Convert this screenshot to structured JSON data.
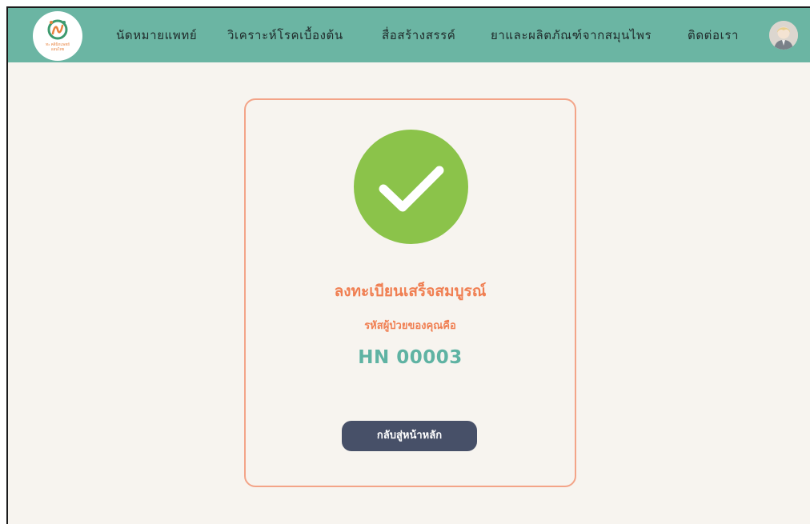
{
  "header": {
    "logo_text": [
      "ทะ คลินิกแพทย์",
      "แผนไทย"
    ],
    "nav": [
      {
        "label": "นัดหมายแพทย์"
      },
      {
        "label": "วิเคราะห์โรคเบื้องต้น"
      },
      {
        "label": "สื่อสร้างสรรค์"
      },
      {
        "label": "ยาและผลิตภัณฑ์จากสมุนไพร"
      },
      {
        "label": "ติดต่อเรา"
      }
    ],
    "avatar_icon": "user-avatar-icon"
  },
  "confirmation": {
    "icon": "check-circle-icon",
    "title": "ลงทะเบียนเสร็จสมบูรณ์",
    "subtitle": "รหัสผู้ป่วยของคุณคือ",
    "patient_code": "HN 00003",
    "button_label": "กลับสู่หน้าหลัก"
  },
  "colors": {
    "header_bg": "#6bb5a3",
    "page_bg": "#f7f4ef",
    "card_border": "#f3a488",
    "check_bg": "#8bc34a",
    "title_text": "#f07f52",
    "code_text": "#5fb3a3",
    "button_bg": "#475068"
  }
}
